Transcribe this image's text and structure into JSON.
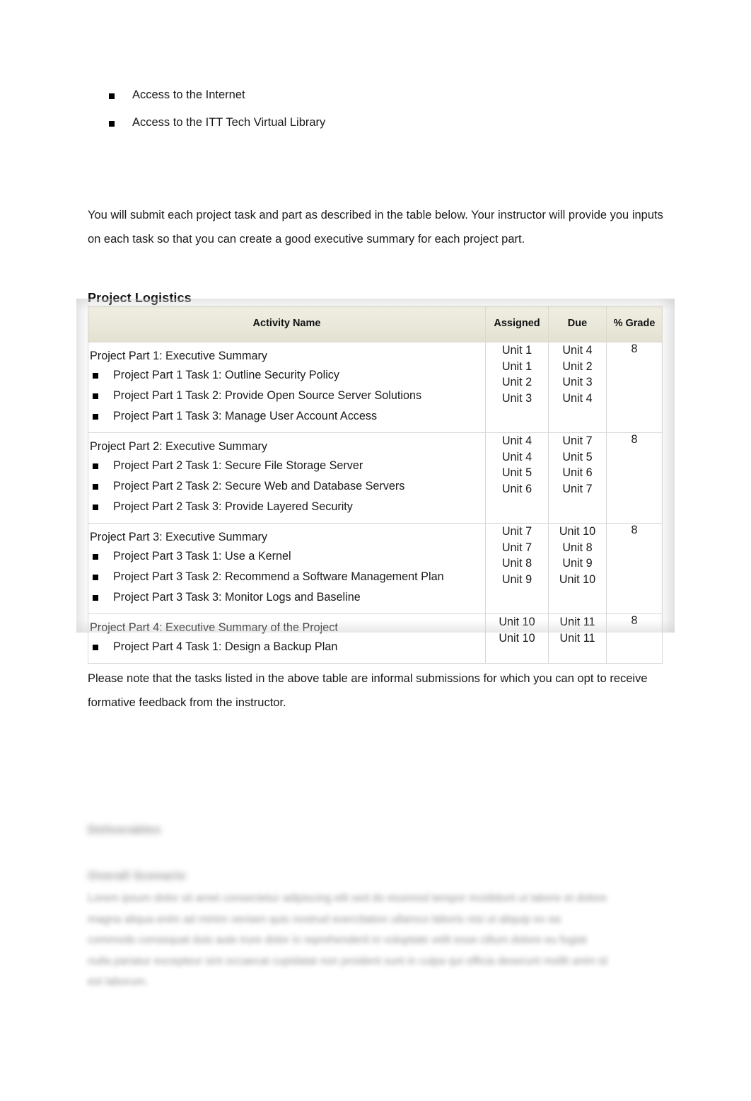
{
  "document": {
    "top_bullets": [
      {
        "text": "Access to the Internet"
      },
      {
        "text": "Access to the ITT Tech Virtual Library"
      }
    ],
    "intro_paragraph": "You will submit each project task and part as described in the table below. Your instructor will provide you inputs on each task so that you can create a good executive summary for each project part.",
    "section_heading": "Project Logistics",
    "note_paragraph": "Please note that the tasks listed in the above table are informal submissions for which you can opt to receive formative feedback from the instructor.",
    "table": {
      "columns": [
        "Activity Name",
        "Assigned",
        "Due",
        "% Grade"
      ],
      "rows": [
        {
          "title": "Project Part 1: Executive Summary",
          "tasks": [
            "Project Part 1 Task 1: Outline Security Policy",
            "Project Part 1 Task 2: Provide Open Source Server Solutions",
            "Project Part 1 Task 3: Manage User Account Access"
          ],
          "assigned": [
            "Unit 1",
            "Unit 1",
            "Unit 2",
            "Unit 3"
          ],
          "due": [
            "Unit 4",
            "Unit 2",
            "Unit 3",
            "Unit 4"
          ],
          "grade": "8"
        },
        {
          "title": "Project Part 2: Executive Summary",
          "tasks": [
            "Project Part 2 Task 1: Secure File Storage Server",
            "Project Part 2 Task 2: Secure Web and Database Servers",
            "Project Part 2 Task 3: Provide Layered Security"
          ],
          "assigned": [
            "Unit 4",
            "Unit 4",
            "Unit 5",
            "Unit 6"
          ],
          "due": [
            "Unit 7",
            "Unit 5",
            "Unit 6",
            "Unit 7"
          ],
          "grade": "8"
        },
        {
          "title": "Project Part 3: Executive Summary",
          "tasks": [
            "Project Part 3 Task 1: Use a Kernel",
            "Project Part 3 Task 2: Recommend a Software Management Plan",
            "Project Part 3 Task 3: Monitor Logs and Baseline"
          ],
          "assigned": [
            "Unit 7",
            "Unit 7",
            "Unit 8",
            "Unit 9"
          ],
          "due": [
            "Unit 10",
            "Unit 8",
            "Unit 9",
            "Unit 10"
          ],
          "grade": "8"
        },
        {
          "title": "Project Part 4: Executive Summary of the Project",
          "tasks": [
            "Project Part 4 Task 1: Design a Backup Plan"
          ],
          "assigned": [
            "Unit 10",
            "Unit 10"
          ],
          "due": [
            "Unit 11",
            "Unit 11"
          ],
          "grade": "8"
        }
      ]
    },
    "blurred_section": {
      "heading_1": "Deliverables",
      "heading_2": "Overall Scenario",
      "body": "Lorem ipsum dolor sit amet consectetur adipiscing elit sed do eiusmod tempor incididunt ut labore et dolore magna aliqua enim ad minim veniam quis nostrud exercitation ullamco laboris nisi ut aliquip ex ea commodo consequat duis aute irure dolor in reprehenderit in voluptate velit esse cillum dolore eu fugiat nulla pariatur excepteur sint occaecat cupidatat non proident sunt in culpa qui officia deserunt mollit anim id est laborum."
    }
  }
}
